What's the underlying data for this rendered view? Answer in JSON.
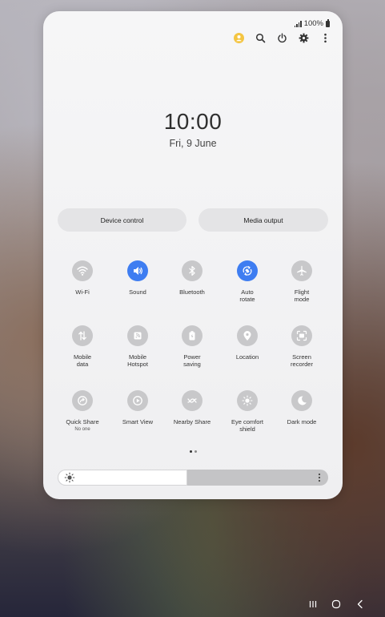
{
  "status_bar": {
    "battery_text": "100%"
  },
  "clock": {
    "time": "10:00",
    "date": "Fri, 9 June"
  },
  "quick_panel": {
    "device_control_label": "Device control",
    "media_output_label": "Media output"
  },
  "tiles": [
    {
      "label": "Wi-Fi",
      "icon": "wifi-icon",
      "on": false
    },
    {
      "label": "Sound",
      "icon": "volume-icon",
      "on": true
    },
    {
      "label": "Bluetooth",
      "icon": "bluetooth-icon",
      "on": false
    },
    {
      "label": "Auto\nrotate",
      "icon": "rotate-icon",
      "on": true
    },
    {
      "label": "Flight\nmode",
      "icon": "airplane-icon",
      "on": false
    },
    {
      "label": "Mobile\ndata",
      "icon": "data-arrows-icon",
      "on": false
    },
    {
      "label": "Mobile\nHotspot",
      "icon": "hotspot-icon",
      "on": false
    },
    {
      "label": "Power\nsaving",
      "icon": "battery-saver-icon",
      "on": false
    },
    {
      "label": "Location",
      "icon": "location-pin-icon",
      "on": false
    },
    {
      "label": "Screen\nrecorder",
      "icon": "screen-record-icon",
      "on": false
    },
    {
      "label": "Quick Share",
      "sublabel": "No one",
      "icon": "quick-share-icon",
      "on": false
    },
    {
      "label": "Smart View",
      "icon": "smart-view-icon",
      "on": false
    },
    {
      "label": "Nearby Share",
      "icon": "nearby-share-icon",
      "on": false
    },
    {
      "label": "Eye comfort\nshield",
      "icon": "eye-comfort-icon",
      "on": false
    },
    {
      "label": "Dark mode",
      "icon": "moon-icon",
      "on": false
    }
  ],
  "brightness": {
    "level": 0.48
  },
  "colors": {
    "accent": "#3e7df1",
    "tile_off": "#c8c8ca",
    "avatar": "#f4c542"
  },
  "pagination": {
    "current": 1,
    "total": 2
  }
}
